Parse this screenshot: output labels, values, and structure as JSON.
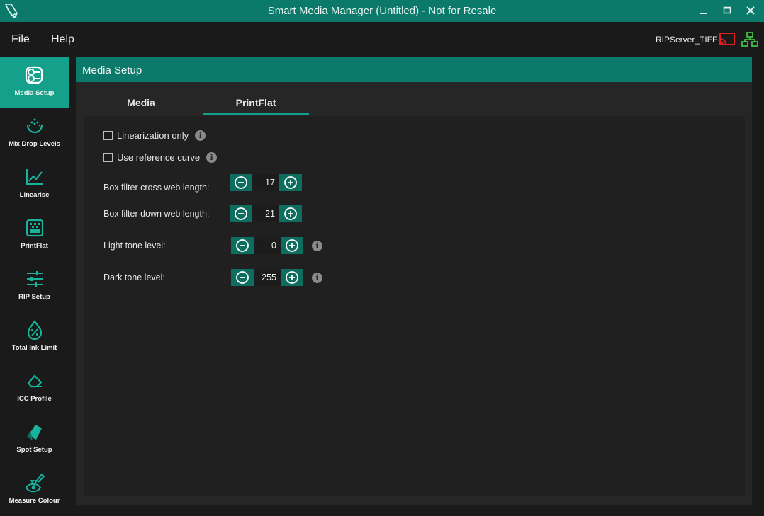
{
  "window": {
    "title": "Smart Media Manager (Untitled) - Not for Resale",
    "accent": "#0b7a6a",
    "active_accent": "#14a08b"
  },
  "menu": {
    "file": "File",
    "help": "Help"
  },
  "server": {
    "name": "RIPServer_TIFF",
    "cast_icon_color": "#e02020",
    "network_icon_color": "#3fbf3f"
  },
  "sidebar": {
    "items": [
      {
        "label": "Media Setup",
        "icon": "media-roll-icon",
        "active": true
      },
      {
        "label": "Mix Drop Levels",
        "icon": "drop-mix-icon",
        "active": false
      },
      {
        "label": "Linearise",
        "icon": "line-chart-icon",
        "active": false
      },
      {
        "label": "PrintFlat",
        "icon": "printflat-icon",
        "active": false
      },
      {
        "label": "RIP Setup",
        "icon": "sliders-icon",
        "active": false
      },
      {
        "label": "Total Ink Limit",
        "icon": "ink-percent-icon",
        "active": false
      },
      {
        "label": "ICC Profile",
        "icon": "eraser-icon",
        "active": false
      },
      {
        "label": "Spot Setup",
        "icon": "swatch-icon",
        "active": false
      },
      {
        "label": "Measure Colour",
        "icon": "measure-eye-icon",
        "active": false
      }
    ]
  },
  "panel": {
    "title": "Media Setup",
    "tabs": [
      {
        "label": "Media",
        "selected": false
      },
      {
        "label": "PrintFlat",
        "selected": true
      }
    ],
    "linearization_only": {
      "label": "Linearization only",
      "checked": false
    },
    "use_reference_curve": {
      "label": "Use reference curve",
      "checked": false
    },
    "info_glyph": "i",
    "fields": [
      {
        "label": "Box filter cross web length:",
        "value": "17"
      },
      {
        "label": "Box filter down web length:",
        "value": "21"
      },
      {
        "label": "Light tone level:",
        "value": "0"
      },
      {
        "label": "Dark tone level:",
        "value": "255"
      }
    ]
  }
}
